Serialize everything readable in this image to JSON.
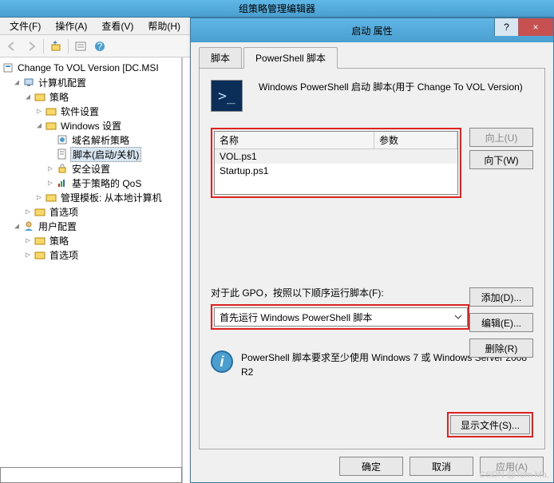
{
  "main_window": {
    "title": "组策略管理编辑器"
  },
  "menubar": {
    "file": "文件(F)",
    "action": "操作(A)",
    "view": "查看(V)",
    "help": "帮助(H)"
  },
  "tree": {
    "root": "Change To VOL Version [DC.MSI",
    "computer_cfg": "计算机配置",
    "policies": "策略",
    "software_settings": "软件设置",
    "windows_settings": "Windows 设置",
    "name_resolution": "域名解析策略",
    "scripts": "脚本(启动/关机)",
    "security_settings": "安全设置",
    "qos": "基于策略的 QoS",
    "admin_templates": "管理模板: 从本地计算机",
    "preferences_1": "首选项",
    "user_cfg": "用户配置",
    "policies_2": "策略",
    "preferences_2": "首选项"
  },
  "dialog": {
    "title": "启动 属性",
    "help": "?",
    "close": "×",
    "tabs": {
      "script": "脚本",
      "powershell": "PowerShell 脚本"
    },
    "heading": "Windows PowerShell 启动 脚本(用于 Change To VOL Version)",
    "list": {
      "col_name": "名称",
      "col_param": "参数",
      "rows": [
        "VOL.ps1",
        "Startup.ps1"
      ]
    },
    "buttons": {
      "up": "向上(U)",
      "down": "向下(W)",
      "add": "添加(D)...",
      "edit": "编辑(E)...",
      "remove": "删除(R)"
    },
    "order_label": "对于此 GPO，按照以下顺序运行脚本(F):",
    "order_value": "首先运行 Windows PowerShell 脚本",
    "info": "PowerShell 脚本要求至少使用 Windows 7 或 Windows Server 2008 R2",
    "show_files": "显示文件(S)...",
    "ok": "确定",
    "cancel": "取消",
    "apply": "应用(A)"
  },
  "watermark": "CSDN @Tom Ma."
}
